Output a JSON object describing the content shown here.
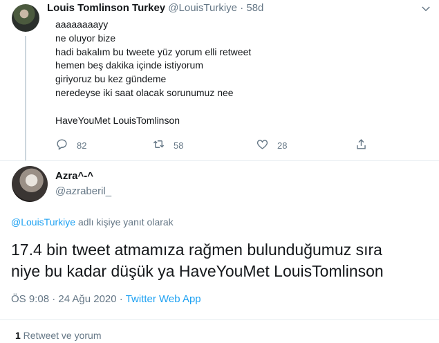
{
  "tweet1": {
    "name": "Louis Tomlinson Turkey",
    "handle": "@LouisTurkiye",
    "separator": "·",
    "age": "58d",
    "lines": [
      "aaaaaaaayy",
      "ne oluyor bize",
      "hadi bakalım bu tweete yüz yorum elli retweet",
      "hemen beş dakika içinde istiyorum",
      "giriyoruz bu kez gündeme",
      "neredeyse iki saat olacak sorunumuz nee",
      "",
      "HaveYouMet LouisTomlinson"
    ],
    "reply_count": "82",
    "retweet_count": "58",
    "like_count": "28"
  },
  "tweet2": {
    "name": "Azra^-^",
    "handle": "@azraberil_",
    "replying_link": "@LouisTurkiye",
    "replying_suffix": " adlı kişiye yanıt olarak",
    "text_line1": "17.4 bin tweet atmamıza rağmen bulunduğumuz sıra",
    "text_line2": "niye bu kadar düşük ya HaveYouMet LouisTomlinson",
    "time_date": "ÖS 9:08 · 24 Ağu 2020 · ",
    "app": "Twitter Web App",
    "retweet_count": "1",
    "retweet_label": " Retweet ve yorum"
  },
  "colors": {
    "accent": "#1da1f2",
    "muted": "#657786",
    "text": "#14171a",
    "border": "#e6ecf0"
  },
  "icons": [
    "chevron-down-icon",
    "reply-icon",
    "retweet-icon",
    "like-icon",
    "share-icon"
  ]
}
